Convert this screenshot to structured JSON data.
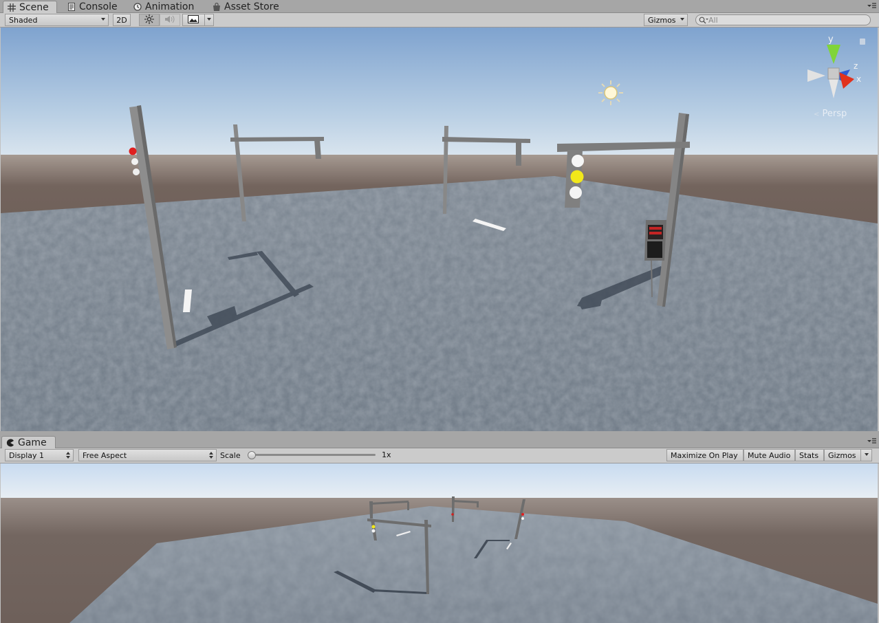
{
  "tabs": [
    {
      "label": "Scene",
      "icon": "grid-icon",
      "active": true
    },
    {
      "label": "Console",
      "icon": "console-icon",
      "active": false
    },
    {
      "label": "Animation",
      "icon": "animation-clock-icon",
      "active": false
    },
    {
      "label": "Asset Store",
      "icon": "shopping-bag-icon",
      "active": false
    }
  ],
  "scene_toolbar": {
    "draw_mode": "Shaded",
    "mode_2d": "2D",
    "gizmos": "Gizmos",
    "search_placeholder": "All"
  },
  "scene_view": {
    "projection_label": "Persp",
    "axis_labels": {
      "y": "y",
      "z": "z",
      "x": "x"
    }
  },
  "game_tab": {
    "label": "Game",
    "icon": "pacman-icon"
  },
  "game_toolbar": {
    "display": "Display 1",
    "aspect": "Free Aspect",
    "scale_label": "Scale",
    "scale_value": "1x",
    "scale_fraction": 0.0,
    "maximize": "Maximize On Play",
    "mute": "Mute Audio",
    "stats": "Stats",
    "gizmos": "Gizmos"
  },
  "colors": {
    "sky_top": "#7fa3cf",
    "horizon": "#e4ecf2",
    "ground_brown": "#6f6059",
    "asphalt": "#7c8590",
    "light_red": "#e02020",
    "light_yellow": "#f2e81a",
    "pole": "#7f7f7f"
  }
}
